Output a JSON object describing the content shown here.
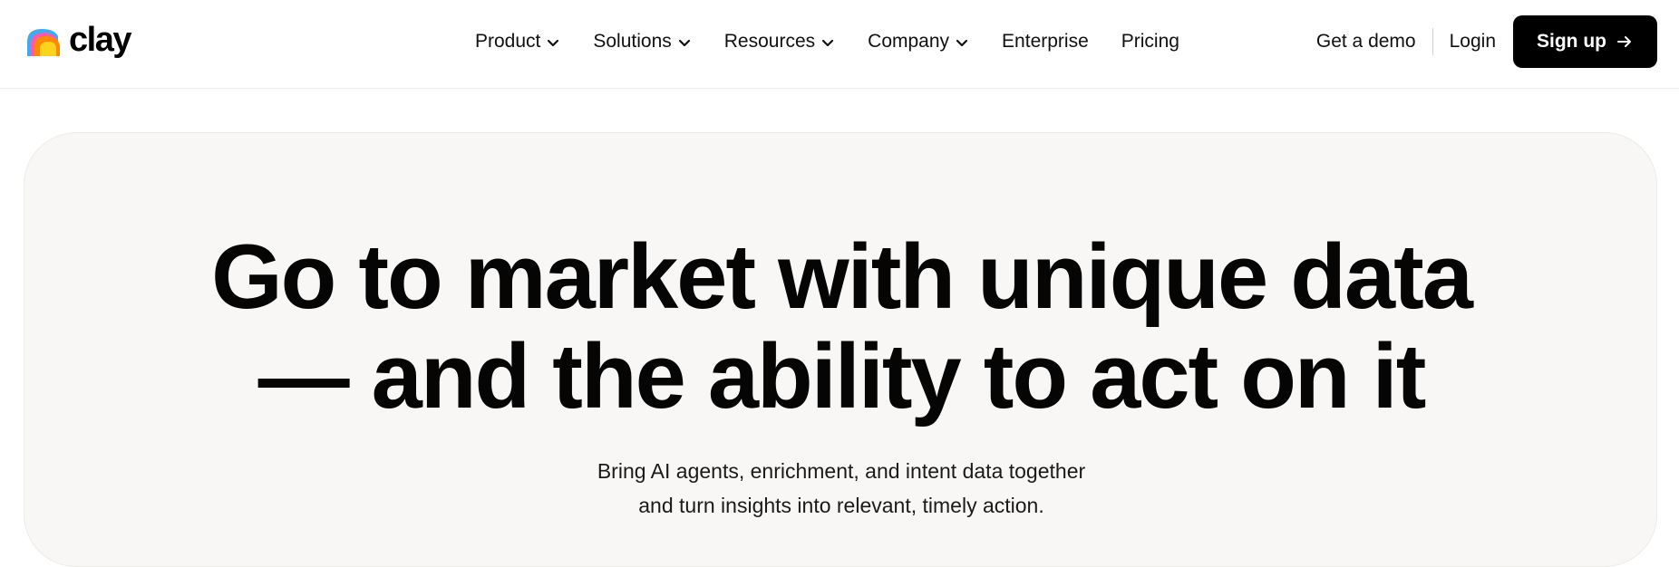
{
  "brand": {
    "name": "clay"
  },
  "nav": {
    "items": [
      {
        "label": "Product",
        "has_dropdown": true
      },
      {
        "label": "Solutions",
        "has_dropdown": true
      },
      {
        "label": "Resources",
        "has_dropdown": true
      },
      {
        "label": "Company",
        "has_dropdown": true
      },
      {
        "label": "Enterprise",
        "has_dropdown": false
      },
      {
        "label": "Pricing",
        "has_dropdown": false
      }
    ]
  },
  "actions": {
    "demo_label": "Get a demo",
    "login_label": "Login",
    "signup_label": "Sign up",
    "signup_icon": "arrow-right-icon"
  },
  "hero": {
    "title_line1": "Go to market with unique data",
    "title_line2": "— and the ability to act on it",
    "subtitle_line1": "Bring AI agents, enrichment, and intent data together",
    "subtitle_line2": "and turn insights into relevant, timely action."
  },
  "colors": {
    "accent": "#000000",
    "hero_bg": "#f8f7f5",
    "logo_blue": "#3fa9f5",
    "logo_orange": "#ff8a00",
    "logo_yellow": "#ffd21f",
    "logo_pink": "#ff5aa5"
  }
}
